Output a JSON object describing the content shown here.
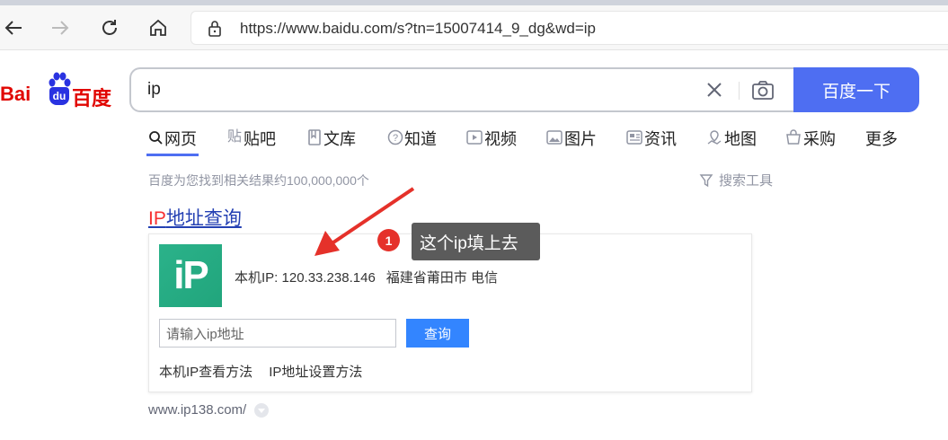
{
  "browser": {
    "url": "https://www.baidu.com/s?tn=15007414_9_dg&wd=ip"
  },
  "logo": {
    "text_left": "Bai",
    "text_mid": "du",
    "text_right": "百度"
  },
  "search": {
    "query": "ip",
    "button_label": "百度一下"
  },
  "tabs": [
    {
      "label": "网页",
      "icon": "search-icon"
    },
    {
      "label": "贴吧",
      "icon": "tieba-icon"
    },
    {
      "label": "文库",
      "icon": "wenku-icon"
    },
    {
      "label": "知道",
      "icon": "zhidao-icon"
    },
    {
      "label": "视频",
      "icon": "video-icon"
    },
    {
      "label": "图片",
      "icon": "image-icon"
    },
    {
      "label": "资讯",
      "icon": "news-icon"
    },
    {
      "label": "地图",
      "icon": "map-icon"
    },
    {
      "label": "采购",
      "icon": "purchase-icon"
    },
    {
      "label": "更多",
      "icon": ""
    }
  ],
  "results_info": {
    "count_text": "百度为您找到相关结果约100,000,000个",
    "tools_label": "搜索工具"
  },
  "result": {
    "title_highlight": "IP",
    "title_rest": "地址查询",
    "logo_text": "iP",
    "ip_label": "本机IP: ",
    "ip_value": "120.33.238.146",
    "ip_location": "福建省莆田市 电信",
    "input_placeholder": "请输入ip地址",
    "query_button": "查询",
    "link_1": "本机IP查看方法",
    "link_2": "IP地址设置方法",
    "url": "www.ip138.com/"
  },
  "annotation": {
    "badge": "1",
    "tooltip": "这个ip填上去",
    "color": "#e5312a"
  },
  "colors": {
    "brand_blue": "#4e6ef2",
    "brand_red": "#e10601",
    "link_blue": "#2440b3",
    "highlight_red": "#f73131"
  }
}
